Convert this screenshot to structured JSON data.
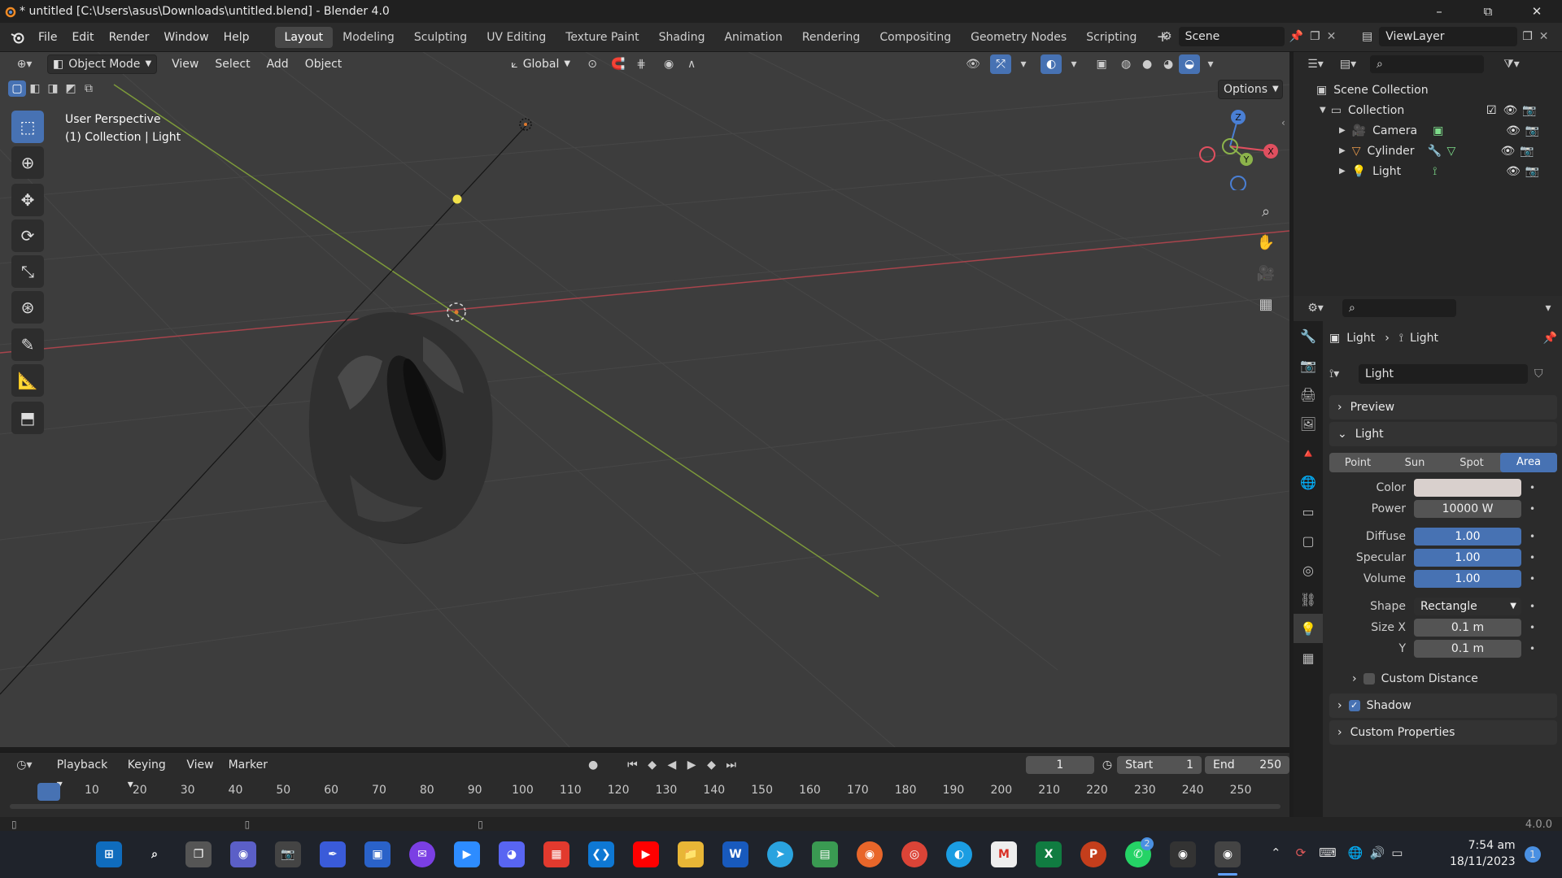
{
  "window": {
    "title": "* untitled [C:\\Users\\asus\\Downloads\\untitled.blend] - Blender 4.0",
    "minimize": "–",
    "maximize": "⧉",
    "close": "✕"
  },
  "menus": [
    "File",
    "Edit",
    "Render",
    "Window",
    "Help"
  ],
  "workspaces": [
    "Layout",
    "Modeling",
    "Sculpting",
    "UV Editing",
    "Texture Paint",
    "Shading",
    "Animation",
    "Rendering",
    "Compositing",
    "Geometry Nodes",
    "Scripting"
  ],
  "workspace_active": "Layout",
  "scene": {
    "name": "Scene",
    "view_layer": "ViewLayer"
  },
  "viewport_header": {
    "mode": "Object Mode",
    "menus": [
      "View",
      "Select",
      "Add",
      "Object"
    ],
    "orientation": "Global",
    "options": "Options"
  },
  "viewport": {
    "perspective": "User Perspective",
    "context": "(1) Collection | Light"
  },
  "gizmo": {
    "x": "X",
    "y": "Y",
    "z": "Z"
  },
  "outliner": {
    "root": "Scene Collection",
    "collection": "Collection",
    "items": [
      {
        "name": "Camera"
      },
      {
        "name": "Cylinder"
      },
      {
        "name": "Light"
      }
    ]
  },
  "properties": {
    "breadcrumb_object": "Light",
    "breadcrumb_data": "Light",
    "datablock": "Light",
    "sections": {
      "preview": "Preview",
      "light": "Light",
      "shadow": "Shadow",
      "custom_properties": "Custom Properties",
      "custom_distance": "Custom Distance"
    },
    "light_types": [
      "Point",
      "Sun",
      "Spot",
      "Area"
    ],
    "light_type_active": "Area",
    "color_label": "Color",
    "color_value": "#d9d0cd",
    "fields": [
      {
        "label": "Power",
        "value": "10000 W",
        "style": "grey"
      },
      {
        "label": "Diffuse",
        "value": "1.00",
        "style": "blue"
      },
      {
        "label": "Specular",
        "value": "1.00",
        "style": "blue"
      },
      {
        "label": "Volume",
        "value": "1.00",
        "style": "blue"
      }
    ],
    "shape_label": "Shape",
    "shape_value": "Rectangle",
    "size_x_label": "Size X",
    "size_x": "0.1 m",
    "size_y_label": "Y",
    "size_y": "0.1 m",
    "shadow_checked": true
  },
  "timeline": {
    "menus": [
      "Playback",
      "Keying",
      "View",
      "Marker"
    ],
    "current_frame": "1",
    "start_label": "Start",
    "start": "1",
    "end_label": "End",
    "end": "250",
    "ticks": [
      "1",
      "10",
      "20",
      "30",
      "40",
      "50",
      "60",
      "70",
      "80",
      "90",
      "100",
      "110",
      "120",
      "130",
      "140",
      "150",
      "160",
      "170",
      "180",
      "190",
      "200",
      "210",
      "220",
      "230",
      "240",
      "250"
    ]
  },
  "statusbar": {
    "version": "4.0.0"
  },
  "taskbar": {
    "time": "7:54 am",
    "date": "18/11/2023",
    "whatsapp_badge": "2",
    "notification_badge": "1"
  },
  "colors": {
    "accent_blue": "#4772b3",
    "x_axis": "#e04f5f",
    "y_axis": "#8cb34b",
    "z_axis": "#4a7fd4",
    "light_dot": "#f2e24a"
  }
}
